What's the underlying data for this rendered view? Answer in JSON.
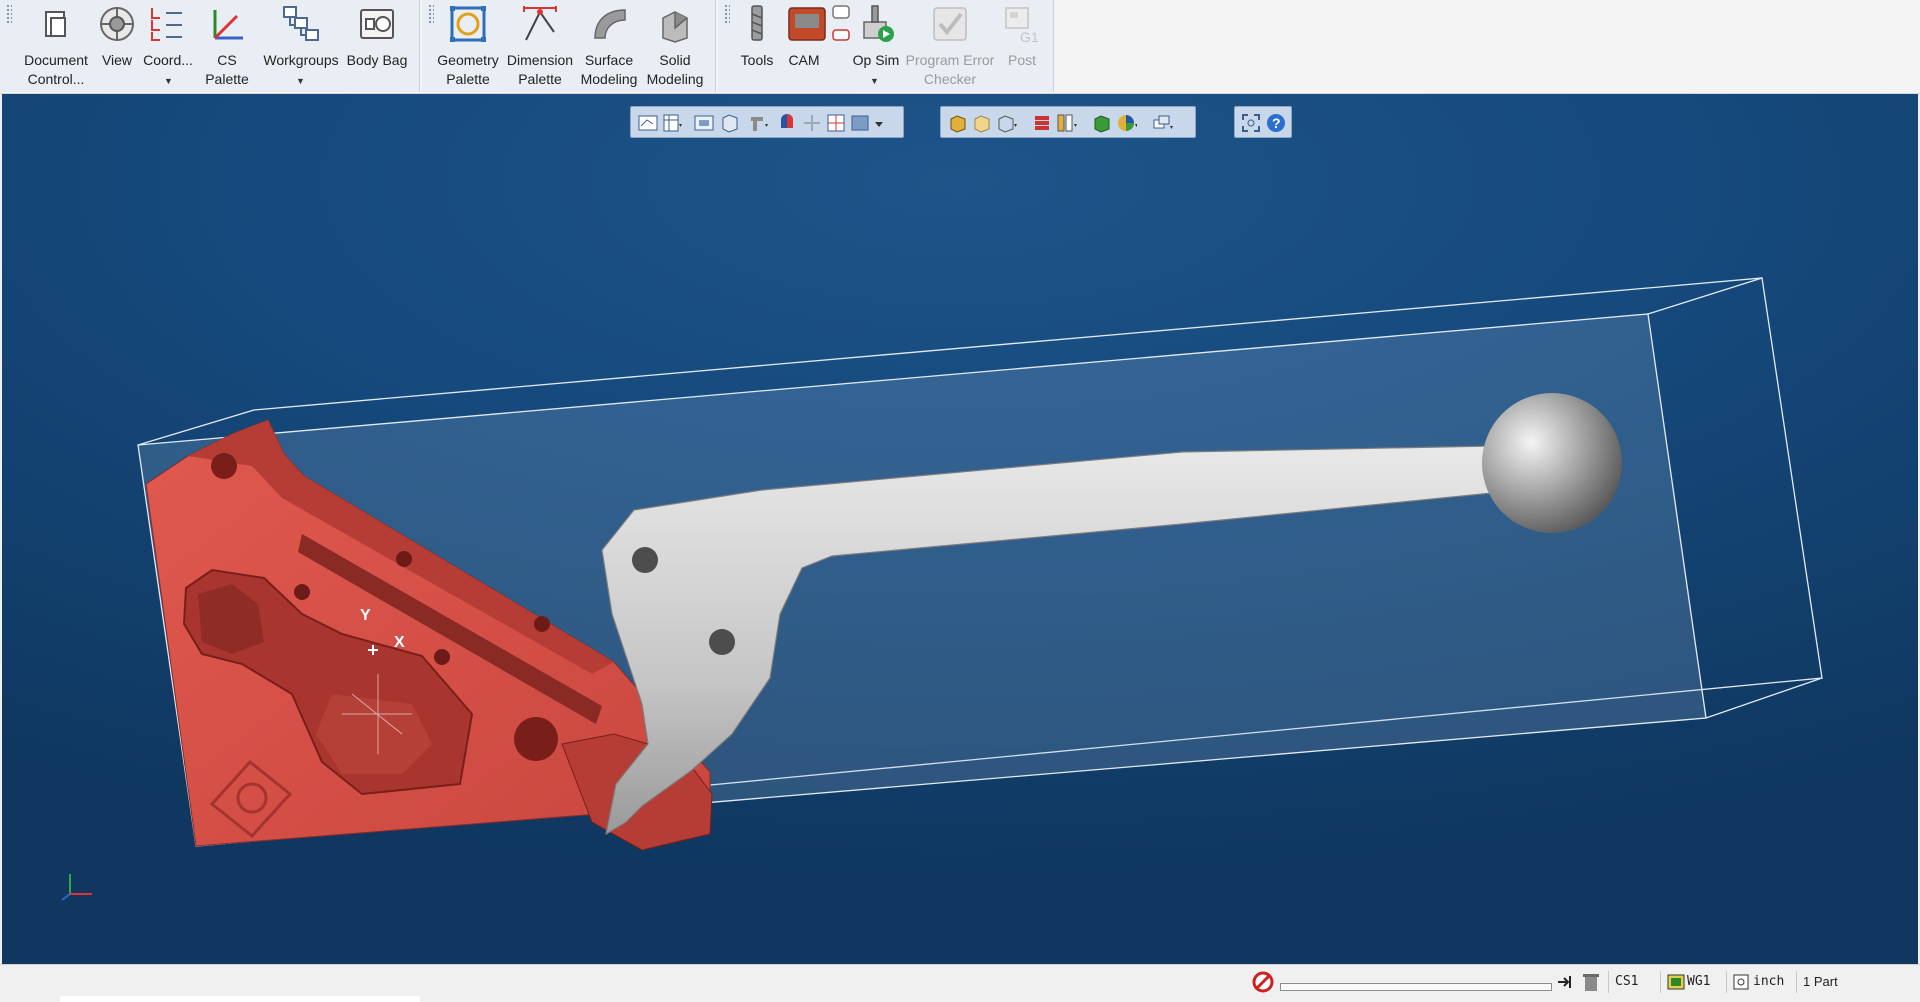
{
  "ribbon": {
    "group1": [
      {
        "label": "Document\nControl...",
        "icon": "document-control-icon"
      },
      {
        "label": "View",
        "icon": "view-icon"
      },
      {
        "label": "Coord...",
        "icon": "coordinate-list-icon"
      },
      {
        "label": "CS Palette",
        "icon": "cs-palette-icon"
      },
      {
        "label": "Workgroups",
        "icon": "workgroups-icon"
      },
      {
        "label": "Body Bag",
        "icon": "body-bag-icon"
      }
    ],
    "group2": [
      {
        "label": "Geometry\nPalette",
        "icon": "geometry-palette-icon"
      },
      {
        "label": "Dimension\nPalette",
        "icon": "dimension-palette-icon"
      },
      {
        "label": "Surface\nModeling",
        "icon": "surface-modeling-icon"
      },
      {
        "label": "Solid\nModeling",
        "icon": "solid-modeling-icon"
      }
    ],
    "group3": [
      {
        "label": "Tools",
        "icon": "tools-icon",
        "enabled": true
      },
      {
        "label": "CAM",
        "icon": "cam-icon",
        "enabled": true
      },
      {
        "label": "Op Sim",
        "icon": "op-sim-icon",
        "enabled": true
      },
      {
        "label": "Program Error\nChecker",
        "icon": "program-error-checker-icon",
        "enabled": false
      },
      {
        "label": "Post",
        "icon": "post-icon",
        "enabled": false
      }
    ]
  },
  "viewport": {
    "axis_labels": {
      "y": "Y",
      "x": "X"
    },
    "colors": {
      "background": "#164a7e",
      "part_red": "#d0534b",
      "part_gray": "#c8c8c8",
      "bounding_box": "#e6eef7"
    }
  },
  "status": {
    "cs": "CS1",
    "wg": "WG1",
    "units": "inch",
    "parts": "1 Part",
    "progress": 0
  }
}
